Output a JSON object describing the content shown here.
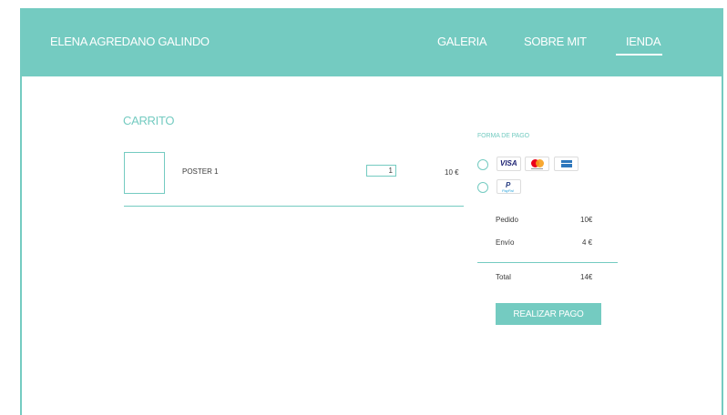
{
  "header": {
    "brand": "ELENA AGREDANO GALINDO",
    "nav": [
      {
        "label": "GALERIA"
      },
      {
        "label": "SOBRE MIT"
      },
      {
        "label": "IENDA",
        "active": true
      }
    ]
  },
  "cart": {
    "title": "CARRITO",
    "items": [
      {
        "name": "POSTER 1",
        "quantity": "1",
        "price": "10 €"
      }
    ]
  },
  "payment": {
    "title": "FORMA DE PAGO",
    "methods": [
      {
        "id": "cards",
        "icons": [
          "visa-icon",
          "mastercard-icon",
          "amex-icon"
        ],
        "card_labels": {
          "visa": "VISA"
        }
      },
      {
        "id": "paypal",
        "icons": [
          "paypal-icon"
        ]
      }
    ]
  },
  "summary": {
    "rows": [
      {
        "label": "Pedido",
        "value": "10€"
      },
      {
        "label": "Envío",
        "value": "4 €"
      }
    ],
    "total": {
      "label": "Total",
      "value": "14€"
    },
    "pay_button": "REALIZAR PAGO"
  },
  "colors": {
    "accent": "#74cbc1",
    "text": "#3a3a3a",
    "white": "#ffffff"
  }
}
